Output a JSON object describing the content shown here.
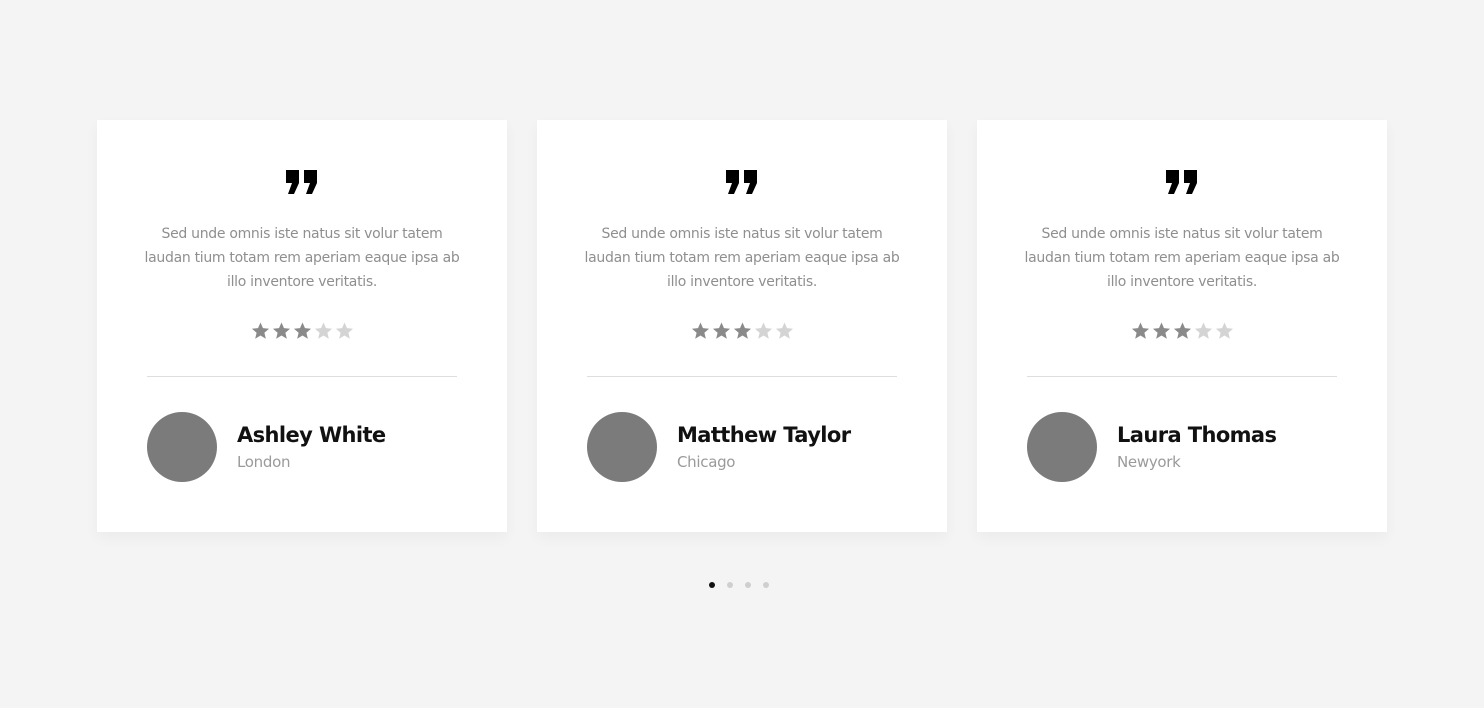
{
  "testimonials": [
    {
      "text": "Sed unde omnis iste natus sit volur tatem laudan tium totam rem aperiam eaque ipsa ab illo inventore veritatis.",
      "rating": 3,
      "max_rating": 5,
      "name": "Ashley White",
      "location": "London",
      "quote_icon": "quote-icon",
      "star_icon": "star-icon"
    },
    {
      "text": "Sed unde omnis iste natus sit volur tatem laudan tium totam rem aperiam eaque ipsa ab illo inventore veritatis.",
      "rating": 3,
      "max_rating": 5,
      "name": "Matthew Taylor",
      "location": "Chicago",
      "quote_icon": "quote-icon",
      "star_icon": "star-icon"
    },
    {
      "text": "Sed unde omnis iste natus sit volur tatem laudan tium totam rem aperiam eaque ipsa ab illo inventore veritatis.",
      "rating": 3,
      "max_rating": 5,
      "name": "Laura Thomas",
      "location": "Newyork",
      "quote_icon": "quote-icon",
      "star_icon": "star-icon"
    }
  ],
  "pagination": {
    "total": 4,
    "active_index": 0
  },
  "colors": {
    "background": "#f4f4f4",
    "card": "#ffffff",
    "star_filled": "#8a8a8a",
    "star_empty": "#d4d4d4",
    "avatar": "#7b7b7b",
    "dot_active": "#111111",
    "dot_inactive": "#cfcfcf"
  }
}
